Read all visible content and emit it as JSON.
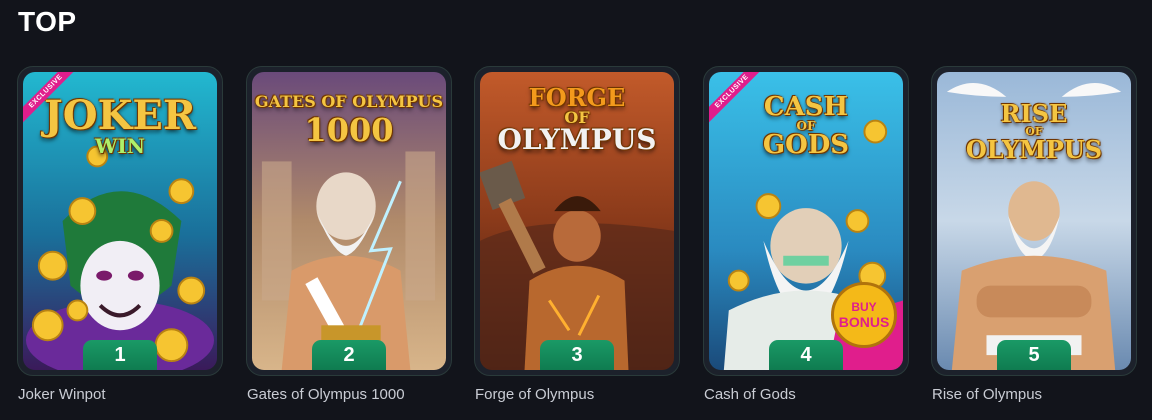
{
  "section": {
    "title": "TOP"
  },
  "games": [
    {
      "name": "Joker Winpot",
      "rank": "1",
      "exclusive": "EXCLUSIVE",
      "logo": [
        "JOKER",
        "WIN"
      ]
    },
    {
      "name": "Gates of Olympus 1000",
      "rank": "2",
      "logo": [
        "GATES OF OLYMPUS",
        "1000"
      ]
    },
    {
      "name": "Forge of Olympus",
      "rank": "3",
      "logo": [
        "FORGE",
        "OF",
        "OLYMPUS"
      ]
    },
    {
      "name": "Cash of Gods",
      "rank": "4",
      "exclusive": "EXCLUSIVE",
      "logo": [
        "CASH",
        "OF",
        "GODS"
      ],
      "badge": [
        "BUY",
        "BONUS"
      ]
    },
    {
      "name": "Rise of Olympus",
      "rank": "5",
      "logo": [
        "RISE",
        "OF",
        "OLYMPUS"
      ]
    }
  ],
  "colors": {
    "background": "#12141b",
    "rank_badge": "#12885a",
    "exclusive_ribbon": "#e01e8c",
    "logo_gold": "#f4c542"
  }
}
